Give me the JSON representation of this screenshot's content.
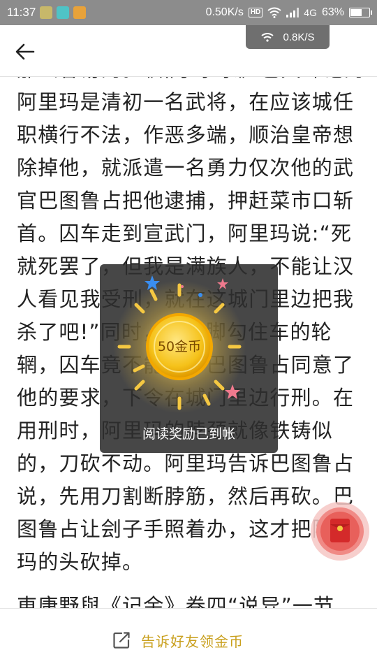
{
  "status_bar": {
    "time": "11:37",
    "net_speed": "0.50K/s",
    "hd_label": "HD",
    "network": "4G",
    "battery": "63%",
    "battery_level": 0.63
  },
  "speed_overlay": {
    "speed": "0.8K/S"
  },
  "header": {
    "back_icon": "arrow-left-icon"
  },
  "article": {
    "paragraph_1": "那么容易的。《啸亭杂录》也大肆记的阿里玛是清初一名武将，在应该城任职横行不法，作恶多端，顺治皇帝想除掉他，就派遣一名勇力仅次他的武官巴图鲁占把他逮捕，押赶菜市口斩首。囚车走到宣武门，阿里玛说:“死就死罢了，但我是满族人，不能让汉人看见我受刑，就在这城门里边把我杀了吧!”同时，他用脚勾住车的轮辋，囚车竟不能前。巴图鲁占同意了他的要求，下令在城门里边行刑。在用刑时，阿里玛的脖颈就像铁铸似的，刀砍不动。阿里玛告诉巴图鲁占说，先用刀割断脖筋，然后再砍。巴图鲁占让刽子手照着办，这才把阿里玛的头砍掉。",
    "paragraph_2": "東康野與《记余》卷四“说异”一节，记"
  },
  "reward_toast": {
    "coin_label": "50金币",
    "message": "阅读奖励已到帐"
  },
  "red_packet": {
    "icon": "red-envelope-icon"
  },
  "bottom_bar": {
    "share_label": "告诉好友领金币",
    "share_icon": "share-edit-icon",
    "accent_color": "#c9a01e"
  }
}
